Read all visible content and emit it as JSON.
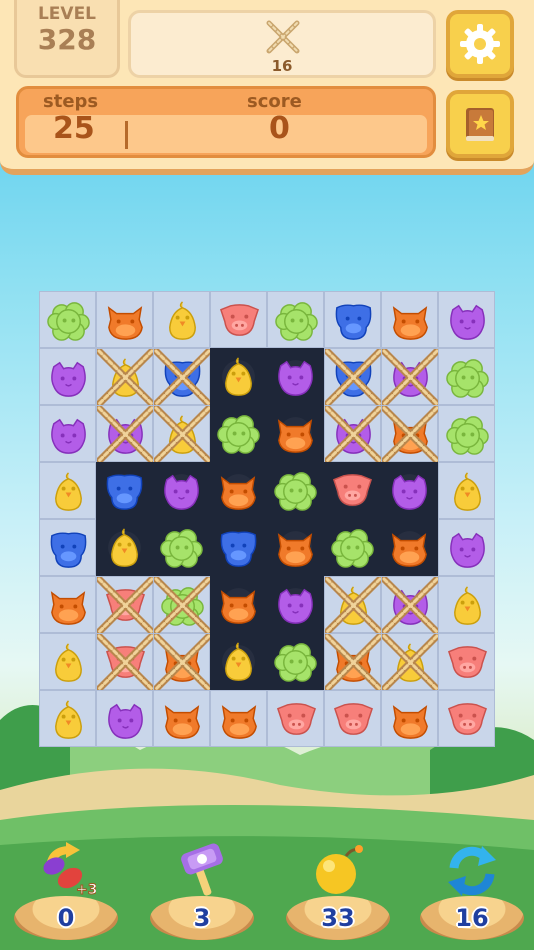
{
  "header": {
    "level_label": "LEVEL",
    "level_value": "328",
    "goal": {
      "icon": "rope-icon",
      "count": "16"
    },
    "steps_label": "steps",
    "steps_value": "25",
    "score_label": "score",
    "score_value": "0",
    "settings_icon": "gear-icon",
    "guide_icon": "book-icon"
  },
  "board": {
    "rows": 8,
    "cols": 8,
    "tiles": [
      [
        "L",
        "L",
        "L",
        "L",
        "L",
        "L",
        "L",
        "L"
      ],
      [
        "L",
        "L",
        "L",
        "D",
        "D",
        "L",
        "L",
        "L"
      ],
      [
        "L",
        "L",
        "L",
        "D",
        "D",
        "L",
        "L",
        "L"
      ],
      [
        "L",
        "D",
        "D",
        "D",
        "D",
        "D",
        "D",
        "L"
      ],
      [
        "L",
        "D",
        "D",
        "D",
        "D",
        "D",
        "D",
        "L"
      ],
      [
        "L",
        "L",
        "L",
        "D",
        "D",
        "L",
        "L",
        "L"
      ],
      [
        "L",
        "L",
        "L",
        "D",
        "D",
        "L",
        "L",
        "L"
      ],
      [
        "L",
        "L",
        "L",
        "L",
        "L",
        "L",
        "L",
        "L"
      ]
    ],
    "pieces": [
      [
        "sheep",
        "cow",
        "chick",
        "pig",
        "sheep",
        "dog",
        "cow",
        "cat"
      ],
      [
        "cat",
        "chick",
        "dog",
        "chick",
        "cat",
        "dog",
        "cat",
        "sheep"
      ],
      [
        "cat",
        "cat",
        "chick",
        "sheep",
        "cow",
        "cat",
        "cow",
        "sheep"
      ],
      [
        "chick",
        "dog",
        "cat",
        "cow",
        "sheep",
        "pig",
        "cat",
        "chick"
      ],
      [
        "dog",
        "chick",
        "sheep",
        "dog",
        "cow",
        "sheep",
        "cow",
        "cat"
      ],
      [
        "cow",
        "pig",
        "sheep",
        "cow",
        "cat",
        "chick",
        "cat",
        "chick"
      ],
      [
        "chick",
        "pig",
        "cow",
        "chick",
        "sheep",
        "cow",
        "chick",
        "pig"
      ],
      [
        "chick",
        "cat",
        "cow",
        "cow",
        "pig",
        "pig",
        "cow",
        "pig"
      ]
    ],
    "roped": [
      [
        0,
        0,
        0,
        0,
        0,
        0,
        0,
        0
      ],
      [
        0,
        1,
        1,
        0,
        0,
        1,
        1,
        0
      ],
      [
        0,
        1,
        1,
        0,
        0,
        1,
        1,
        0
      ],
      [
        0,
        0,
        0,
        0,
        0,
        0,
        0,
        0
      ],
      [
        0,
        0,
        0,
        0,
        0,
        0,
        0,
        0
      ],
      [
        0,
        1,
        1,
        0,
        0,
        1,
        1,
        0
      ],
      [
        0,
        1,
        1,
        0,
        0,
        1,
        1,
        0
      ],
      [
        0,
        0,
        0,
        0,
        0,
        0,
        0,
        0
      ]
    ],
    "colors": {
      "sheep": "#a6e36a",
      "cow": "#f07a2a",
      "chick": "#f8cc3a",
      "pig": "#f77f7a",
      "dog": "#3e6fe6",
      "cat": "#b35de8"
    }
  },
  "boosters": [
    {
      "name": "swap-booster",
      "icon": "swap-arrows-icon",
      "badge": "+3",
      "count": "0"
    },
    {
      "name": "hammer-booster",
      "icon": "hammer-icon",
      "count": "3"
    },
    {
      "name": "bomb-booster",
      "icon": "bomb-icon",
      "count": "33"
    },
    {
      "name": "shuffle-booster",
      "icon": "shuffle-icon",
      "count": "16"
    }
  ]
}
